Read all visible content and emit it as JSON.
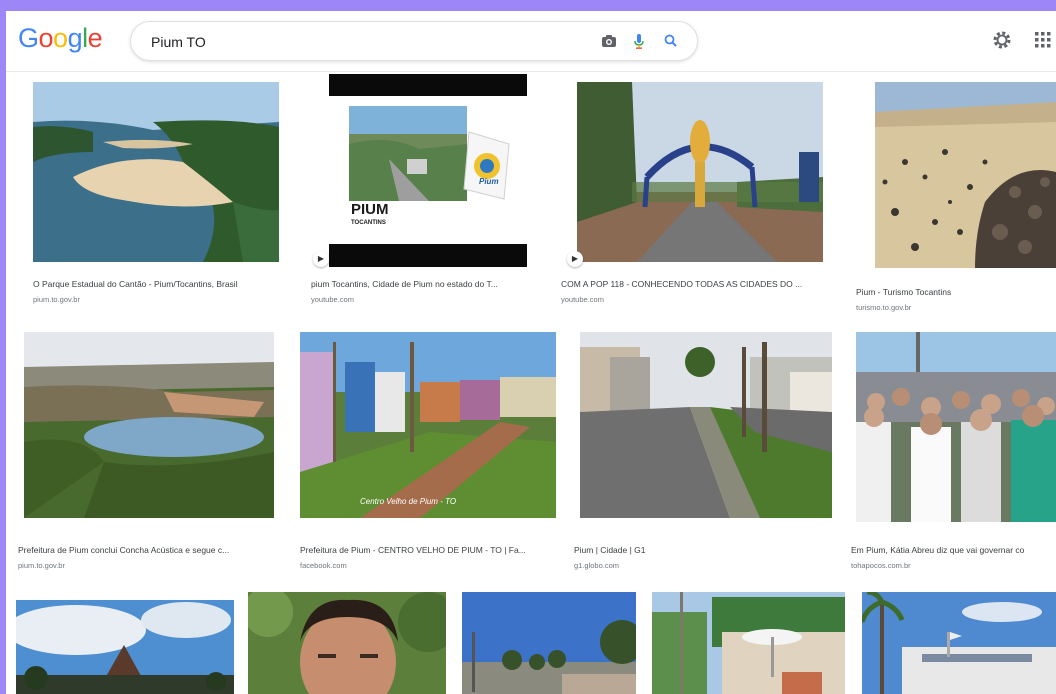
{
  "header": {
    "logo_letters": [
      "G",
      "o",
      "o",
      "g",
      "l",
      "e"
    ],
    "logo_colors": [
      "#4285f4",
      "#ea4335",
      "#fbbc05",
      "#4285f4",
      "#34a853",
      "#ea4335"
    ],
    "search_value": "Pium TO",
    "icons": [
      "camera-icon",
      "mic-icon",
      "search-icon",
      "gear-icon",
      "apps-icon"
    ]
  },
  "results": [
    {
      "caption": "O Parque Estadual do Cantão - Pium/Tocantins, Brasil",
      "source": "pium.to.gov.br"
    },
    {
      "caption": "pium Tocantins, Cidade de Pium no estado do T...",
      "source": "youtube.com",
      "overlay_title": "PIUM",
      "overlay_subtitle": "TOCANTINS",
      "badge": "Pium"
    },
    {
      "caption": "COM A POP 118 - CONHECENDO TODAS AS CIDADES DO ...",
      "source": "youtube.com"
    },
    {
      "caption": "Pium - Turismo Tocantins",
      "source": "turismo.to.gov.br"
    },
    {
      "caption": "Prefeitura de Pium conclui Concha Acústica e segue c...",
      "source": "pium.to.gov.br"
    },
    {
      "caption": "Prefeitura de Pium - CENTRO VELHO DE PIUM - TO | Fa...",
      "source": "facebook.com",
      "overlay_text": "Centro Velho de Pium - TO"
    },
    {
      "caption": "Pium | Cidade | G1",
      "source": "g1.globo.com"
    },
    {
      "caption": "Em Pium, Kátia Abreu diz que vai governar co",
      "source": "tohapocos.com.br"
    },
    {
      "caption": "",
      "source": ""
    },
    {
      "caption": "",
      "source": ""
    },
    {
      "caption": "",
      "source": ""
    },
    {
      "caption": "",
      "source": ""
    },
    {
      "caption": "",
      "source": ""
    }
  ]
}
